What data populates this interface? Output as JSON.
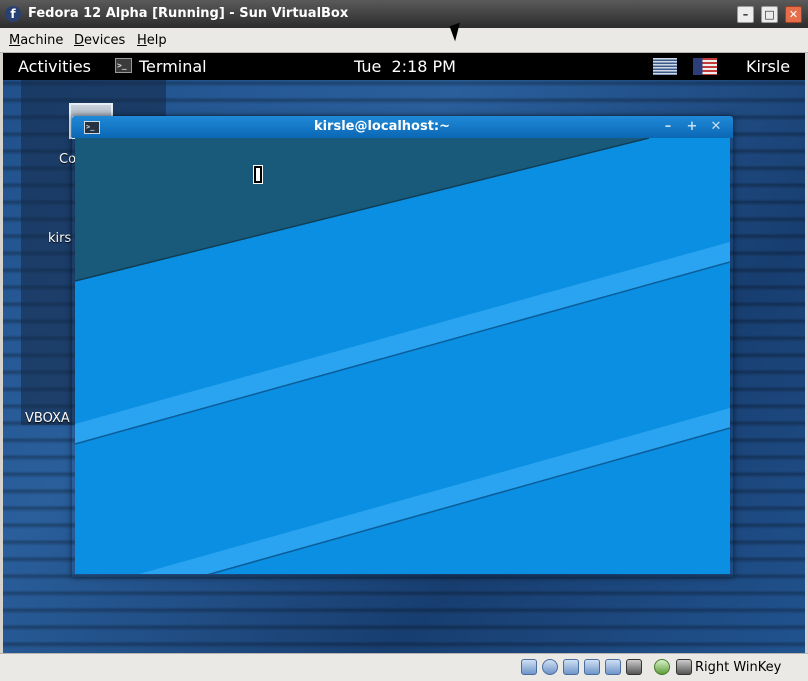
{
  "vbox": {
    "title": "Fedora 12 Alpha [Running] - Sun VirtualBox",
    "menu": [
      "Machine",
      "Devices",
      "Help"
    ],
    "window_buttons": {
      "minimize": "–",
      "maximize": "□",
      "close": "✕"
    },
    "status": {
      "host_key": "Right WinKey",
      "icons": [
        "hard-disk-icon",
        "optical-drive-icon",
        "network-icon",
        "usb-icon",
        "shared-folder-icon",
        "display-icon",
        "mouse-integration-icon",
        "host-key-icon"
      ]
    }
  },
  "guest": {
    "panel": {
      "activities": "Activities",
      "app_icon_glyph": ">_",
      "app_label": "Terminal",
      "clock": "Tue  2:18 PM",
      "user": "Kirsle",
      "tray_icons": [
        "network-status-icon",
        "keyboard-flag-icon"
      ]
    },
    "desktop": {
      "labels": [
        "Co",
        "kirs",
        "VBOXA"
      ]
    },
    "terminal": {
      "title": "kirsle@localhost:~",
      "icon_glyph": ">_",
      "buttons": {
        "minimize": "–",
        "maximize": "+",
        "close": "✕"
      }
    }
  },
  "colors": {
    "terminal_bg": "#0a8fe2",
    "terminal_shade": "#195a7a",
    "titlebar": "#0b67b4"
  }
}
